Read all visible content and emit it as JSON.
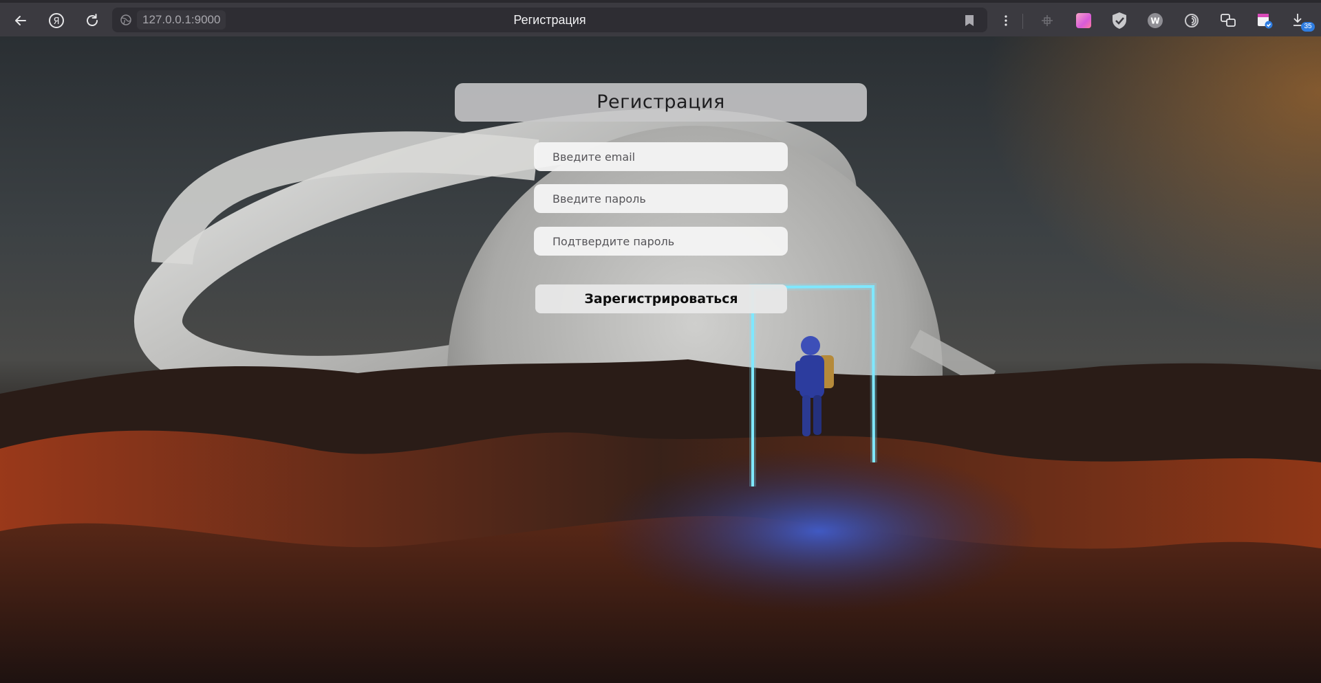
{
  "browser": {
    "url": "127.0.0.1:9000",
    "tab_title": "Регистрация",
    "download_count": "35",
    "extensions": [
      "puzzle-icon",
      "gradient-square-icon",
      "shield-check-icon",
      "w-badge-icon",
      "swirl-icon",
      "chat-bubbles-icon",
      "calendar-check-icon",
      "download-icon"
    ]
  },
  "form": {
    "title": "Регистрация",
    "email_placeholder": "Введите email",
    "password_placeholder": "Введите пароль",
    "confirm_placeholder": "Подтвердите пароль",
    "submit_label": "Зарегистрироваться"
  },
  "colors": {
    "chrome_bg": "#3b3a40",
    "portal_glow": "#7fe9ff",
    "sand_orange": "#b0451f"
  }
}
